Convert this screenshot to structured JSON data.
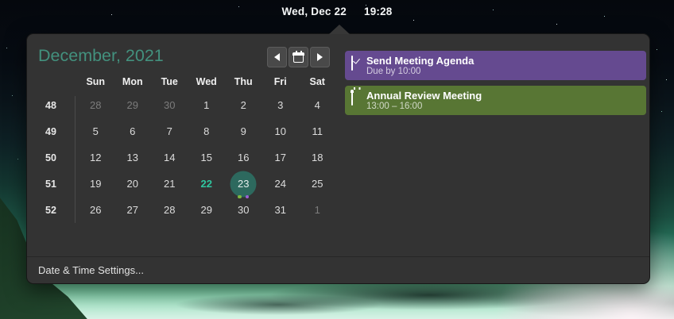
{
  "taskbar": {
    "date": "Wed, Dec 22",
    "time": "19:28"
  },
  "calendar": {
    "title": "December, 2021",
    "nav": {
      "prev_icon": "left-arrow",
      "today_icon": "calendar",
      "next_icon": "right-arrow"
    },
    "weekday_headers": [
      "Sun",
      "Mon",
      "Tue",
      "Wed",
      "Thu",
      "Fri",
      "Sat"
    ],
    "weeks": [
      {
        "week_number": "48",
        "days": [
          {
            "label": "28",
            "state": "muted"
          },
          {
            "label": "29",
            "state": "muted"
          },
          {
            "label": "30",
            "state": "muted"
          },
          {
            "label": "1"
          },
          {
            "label": "2"
          },
          {
            "label": "3"
          },
          {
            "label": "4"
          }
        ]
      },
      {
        "week_number": "49",
        "days": [
          {
            "label": "5"
          },
          {
            "label": "6"
          },
          {
            "label": "7"
          },
          {
            "label": "8"
          },
          {
            "label": "9"
          },
          {
            "label": "10"
          },
          {
            "label": "11"
          }
        ]
      },
      {
        "week_number": "50",
        "days": [
          {
            "label": "12"
          },
          {
            "label": "13"
          },
          {
            "label": "14"
          },
          {
            "label": "15"
          },
          {
            "label": "16"
          },
          {
            "label": "17"
          },
          {
            "label": "18"
          }
        ]
      },
      {
        "week_number": "51",
        "days": [
          {
            "label": "19"
          },
          {
            "label": "20"
          },
          {
            "label": "21"
          },
          {
            "label": "22",
            "state": "today"
          },
          {
            "label": "23",
            "state": "selected",
            "event_dots": [
              "#7eb73f",
              "#9b5fd6"
            ]
          },
          {
            "label": "24"
          },
          {
            "label": "25"
          }
        ]
      },
      {
        "week_number": "52",
        "days": [
          {
            "label": "26"
          },
          {
            "label": "27"
          },
          {
            "label": "28"
          },
          {
            "label": "29"
          },
          {
            "label": "30"
          },
          {
            "label": "31"
          },
          {
            "label": "1",
            "state": "muted"
          }
        ]
      }
    ]
  },
  "events": [
    {
      "title": "Send Meeting Agenda",
      "subtitle": "Due by 10:00",
      "color": "#654a90",
      "icon": "task-checkbox"
    },
    {
      "title": "Annual Review Meeting",
      "subtitle": "13:00 – 16:00",
      "color": "#587634",
      "icon": "calendar"
    }
  ],
  "footer": {
    "settings_label": "Date & Time Settings..."
  },
  "colors": {
    "accent_teal": "#43917e",
    "today_text": "#2fc7a0",
    "selected_circle": "#2d695e",
    "event_purple": "#654a90",
    "event_green": "#587634",
    "popup_bg": "#333333"
  }
}
